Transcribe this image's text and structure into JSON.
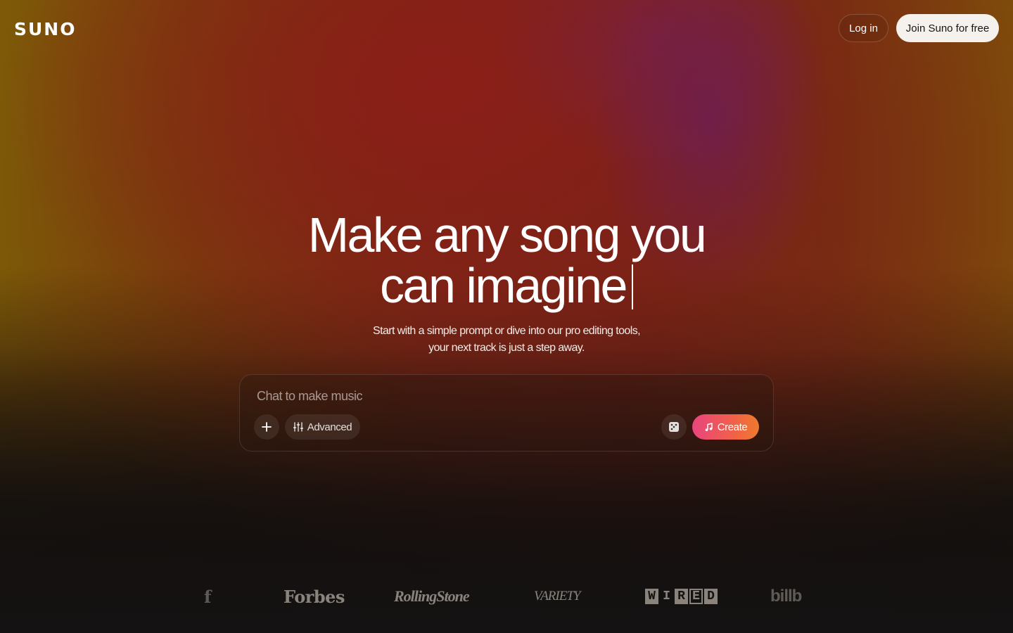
{
  "header": {
    "logo": "SUNO",
    "login_label": "Log in",
    "join_label": "Join Suno for free"
  },
  "hero": {
    "title_line1": "Make any song you",
    "title_line2": "can imagine",
    "subtitle": "Start with a simple prompt or dive into our pro editing tools, your next track is just a step away."
  },
  "composer": {
    "placeholder": "Chat to make music",
    "advanced_label": "Advanced",
    "create_label": "Create",
    "icons": [
      "plus-icon",
      "sliders-icon",
      "dice-icon",
      "music-note-icon"
    ]
  },
  "press": {
    "logos": [
      "Forbes",
      "RollingStone",
      "VARIETY",
      "WIRED",
      "billboard"
    ],
    "fragment_left": "f",
    "forbes": "Forbes",
    "rolling_stone": "RollingStone",
    "variety": "VARIETY",
    "wired": [
      "W",
      "I",
      "R",
      "E",
      "D"
    ],
    "billboard_partial": "billb"
  },
  "colors": {
    "create_gradient_start": "#e8457e",
    "create_gradient_end": "#ef7a2c",
    "join_button_bg": "#f5f1ec"
  }
}
